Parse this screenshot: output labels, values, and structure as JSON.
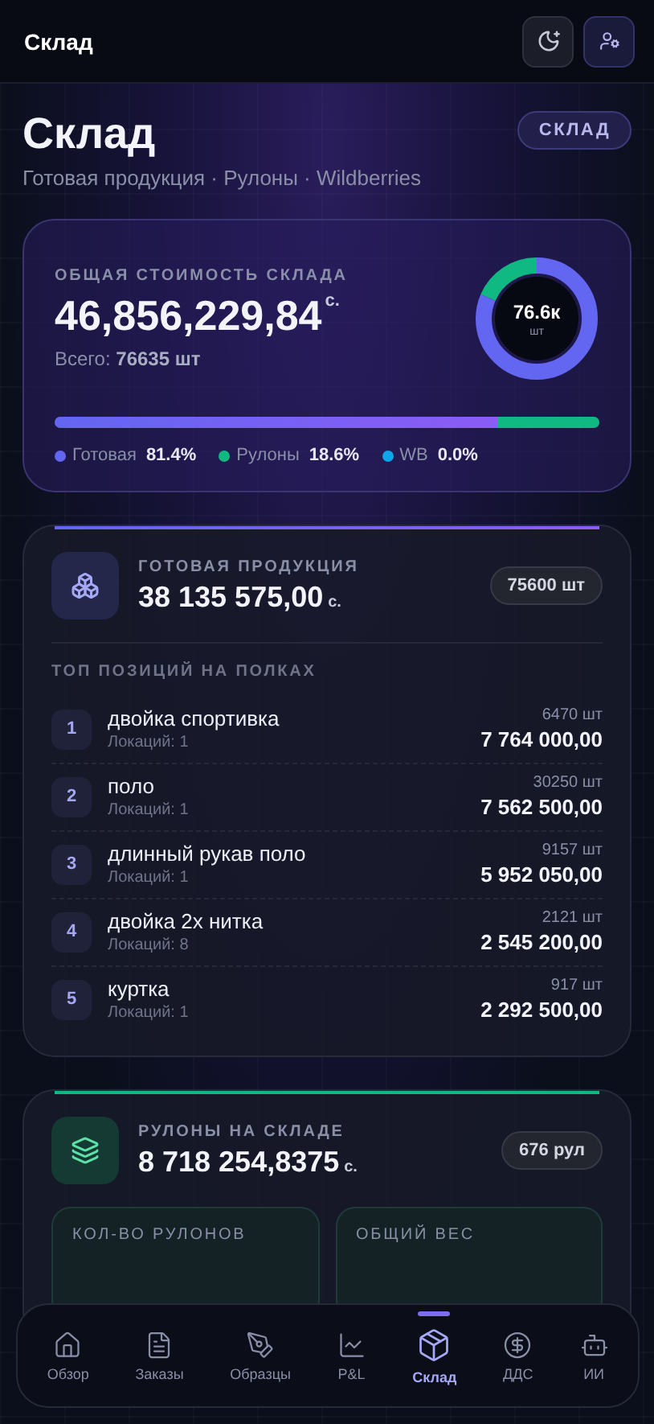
{
  "header": {
    "title": "Склад"
  },
  "hero": {
    "title": "Склад",
    "subtitle": "Готовая продукция · Рулоны · Wildberries",
    "badge": "СКЛАД"
  },
  "summary": {
    "label": "ОБЩАЯ СТОИМОСТЬ СКЛАДА",
    "value": "46,856,229,84",
    "currency": "с.",
    "total_label": "Всего:",
    "total_value": "76635 шт",
    "donut_center": "76.6к",
    "donut_unit": "шт",
    "segments": [
      {
        "name": "Готовая",
        "percent": "81.4%",
        "level": 0.814,
        "color": "#6366f1"
      },
      {
        "name": "Рулоны",
        "percent": "18.6%",
        "level": 0.186,
        "color": "#10b981"
      },
      {
        "name": "WB",
        "percent": "0.0%",
        "level": 0,
        "color": "#0ea5e9"
      }
    ]
  },
  "products": {
    "label": "ГОТОВАЯ ПРОДУКЦИЯ",
    "value": "38 135 575,00",
    "currency": "с.",
    "count": "75600 шт",
    "section": "ТОП ПОЗИЦИЙ НА ПОЛКАХ",
    "items": [
      {
        "rank": "1",
        "name": "двойка спортивка",
        "locations": "Локаций: 1",
        "qty": "6470 шт",
        "amount": "7 764 000,00"
      },
      {
        "rank": "2",
        "name": "поло",
        "locations": "Локаций: 1",
        "qty": "30250 шт",
        "amount": "7 562 500,00"
      },
      {
        "rank": "3",
        "name": "длинный рукав поло",
        "locations": "Локаций: 1",
        "qty": "9157 шт",
        "amount": "5 952 050,00"
      },
      {
        "rank": "4",
        "name": "двойка 2х нитка",
        "locations": "Локаций: 8",
        "qty": "2121 шт",
        "amount": "2 545 200,00"
      },
      {
        "rank": "5",
        "name": "куртка",
        "locations": "Локаций: 1",
        "qty": "917 шт",
        "amount": "2 292 500,00"
      }
    ]
  },
  "rolls": {
    "label": "РУЛОНЫ НА СКЛАДЕ",
    "value": "8 718 254,8375",
    "currency": "с.",
    "count": "676 рул",
    "stats": [
      {
        "label": "КОЛ-ВО РУЛОНОВ"
      },
      {
        "label": "ОБЩИЙ ВЕС"
      }
    ]
  },
  "nav": [
    {
      "kind": "home",
      "label": "Обзор",
      "selected": false
    },
    {
      "kind": "orders",
      "label": "Заказы",
      "selected": false
    },
    {
      "kind": "samples",
      "label": "Образцы",
      "selected": false
    },
    {
      "kind": "pnl",
      "label": "P&L",
      "selected": false
    },
    {
      "kind": "stock",
      "label": "Склад",
      "selected": true
    },
    {
      "kind": "cash",
      "label": "ДДС",
      "selected": false
    },
    {
      "kind": "ai",
      "label": "ИИ",
      "selected": false
    }
  ]
}
